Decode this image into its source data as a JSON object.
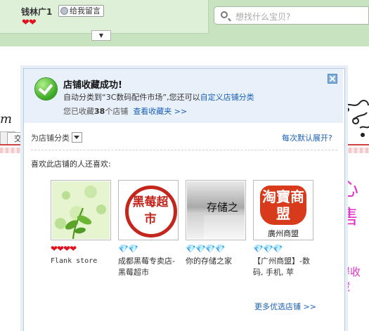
{
  "header": {
    "shop_name": "钱林广1",
    "message_button": "给我留言",
    "hearts": "❤❤",
    "search_placeholder": "想找什么宝贝?"
  },
  "background": {
    "nav_tab_label": "交",
    "big_char": "心售",
    "red_text": "得收藏"
  },
  "popup": {
    "title": "店铺收藏成功!",
    "line2_prefix": "自动分类到",
    "line2_category": "“3C数码配件市场”",
    "line2_middle": ",您还可以",
    "line2_link": "自定义店铺分类",
    "line3_prefix": "您已收藏",
    "line3_count": "38",
    "line3_suffix": "个店铺",
    "line3_link": "查看收藏夹 >>",
    "category_label": "为店铺分类",
    "expand_link": "每次默认展开?",
    "reco_title": "喜欢此店铺的人还喜欢:",
    "more_link": "更多优选店铺 >>",
    "shops": [
      {
        "name": "Flank store",
        "rating": "❤❤❤❤",
        "rating_type": "red"
      },
      {
        "name": "成都黑莓专卖店-黑莓超市",
        "rating": "💎💎",
        "rating_type": "dia",
        "stamp_text": "黑莓超市"
      },
      {
        "name": "你的存储之家",
        "rating": "💎💎💎💎",
        "rating_type": "dia",
        "thumb_text": "存储之"
      },
      {
        "name": "【广州商盟】-数码, 手机, 苹",
        "rating": "💎💎💎",
        "rating_type": "dia",
        "stamp_text": "淘寶商盟",
        "stamp_sub": "廣州商盟"
      }
    ]
  }
}
